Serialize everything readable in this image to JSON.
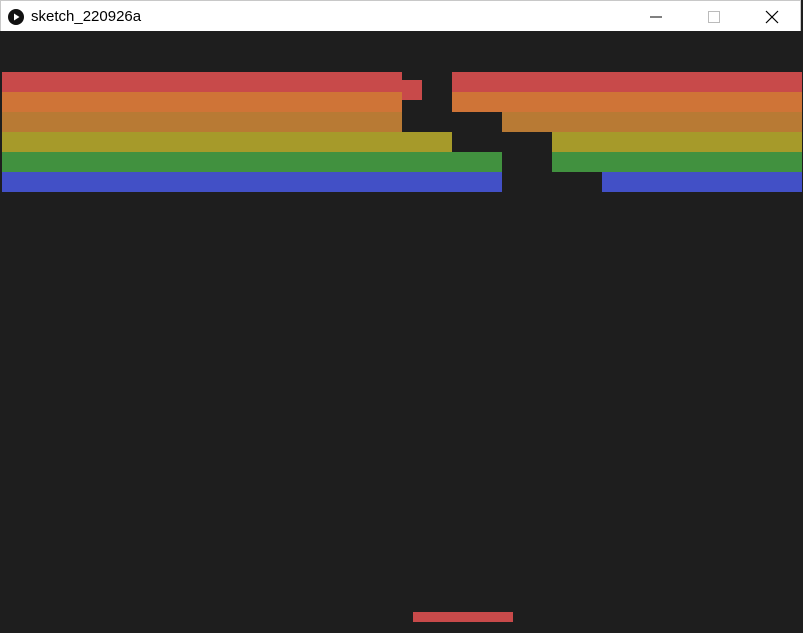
{
  "window": {
    "title": "sketch_220926a",
    "icon": "play-circle-icon",
    "controls": [
      "minimize-icon",
      "maximize-icon",
      "close-icon"
    ]
  },
  "game": {
    "rows": [
      {
        "color": "#c84a4a",
        "bricks": [
          1,
          1,
          1,
          1,
          1,
          1,
          1,
          1,
          0,
          1,
          1,
          1,
          1,
          1,
          1,
          1
        ]
      },
      {
        "color": "#cf7437",
        "bricks": [
          1,
          1,
          1,
          1,
          1,
          1,
          1,
          1,
          0,
          1,
          1,
          1,
          1,
          1,
          1,
          1
        ]
      },
      {
        "color": "#b87a34",
        "bricks": [
          1,
          1,
          1,
          1,
          1,
          1,
          1,
          1,
          0,
          0,
          1,
          1,
          1,
          1,
          1,
          1
        ]
      },
      {
        "color": "#a69a2a",
        "bricks": [
          1,
          1,
          1,
          1,
          1,
          1,
          1,
          1,
          1,
          0,
          0,
          1,
          1,
          1,
          1,
          1
        ]
      },
      {
        "color": "#41913f",
        "bricks": [
          1,
          1,
          1,
          1,
          1,
          1,
          1,
          1,
          1,
          1,
          0,
          1,
          1,
          1,
          1,
          1
        ]
      },
      {
        "color": "#4250c6",
        "bricks": [
          1,
          1,
          1,
          1,
          1,
          1,
          1,
          1,
          1,
          1,
          0,
          0,
          1,
          1,
          1,
          1
        ]
      }
    ],
    "ball": {
      "color": "#c84a4a"
    },
    "paddle": {
      "color": "#c84a4a"
    }
  }
}
